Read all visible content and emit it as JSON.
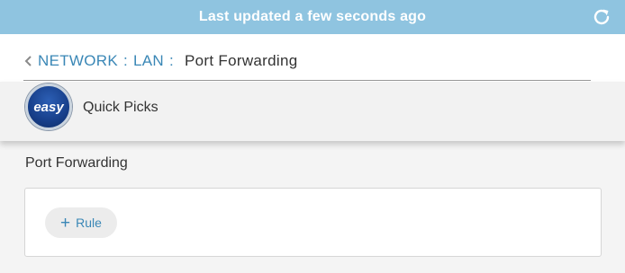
{
  "status_bar": {
    "text": "Last updated a few seconds ago"
  },
  "breadcrumb": {
    "items": [
      "NETWORK",
      "LAN"
    ],
    "separator": ":",
    "current": "Port Forwarding"
  },
  "quick_picks": {
    "logo_text": "easy",
    "label": "Quick Picks"
  },
  "section": {
    "title": "Port Forwarding"
  },
  "add_rule": {
    "plus": "+",
    "label": "Rule"
  },
  "colors": {
    "status_bar_bg": "#8fc4e0",
    "link": "#3a87b6",
    "logo_blue": "#173f8a"
  }
}
